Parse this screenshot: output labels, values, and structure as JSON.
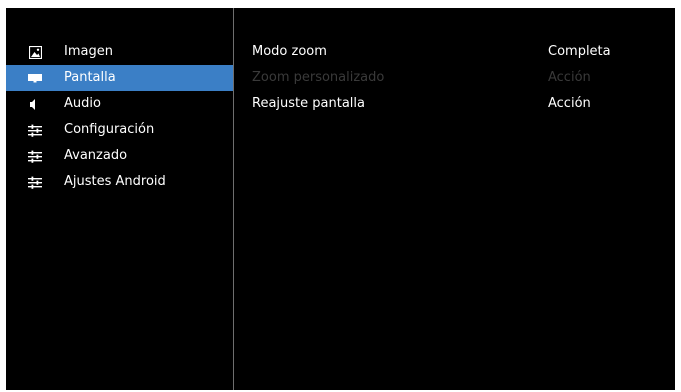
{
  "sidebar": {
    "items": [
      {
        "label": "Imagen",
        "icon": "image-icon",
        "selected": false
      },
      {
        "label": "Pantalla",
        "icon": "screen-icon",
        "selected": true
      },
      {
        "label": "Audio",
        "icon": "speaker-icon",
        "selected": false
      },
      {
        "label": "Configuración",
        "icon": "sliders-icon",
        "selected": false
      },
      {
        "label": "Avanzado",
        "icon": "sliders-icon",
        "selected": false
      },
      {
        "label": "Ajustes Android",
        "icon": "sliders-icon",
        "selected": false
      }
    ]
  },
  "main": {
    "rows": [
      {
        "label": "Modo zoom",
        "value": "Completa",
        "enabled": true
      },
      {
        "label": "Zoom personalizado",
        "value": "Acción",
        "enabled": false
      },
      {
        "label": "Reajuste pantalla",
        "value": "Acción",
        "enabled": true
      }
    ]
  },
  "colors": {
    "background": "#000000",
    "selected": "#3b7fc6",
    "text": "#ffffff",
    "disabled_text": "#3a3a3a",
    "divider": "#6e6e6e"
  }
}
